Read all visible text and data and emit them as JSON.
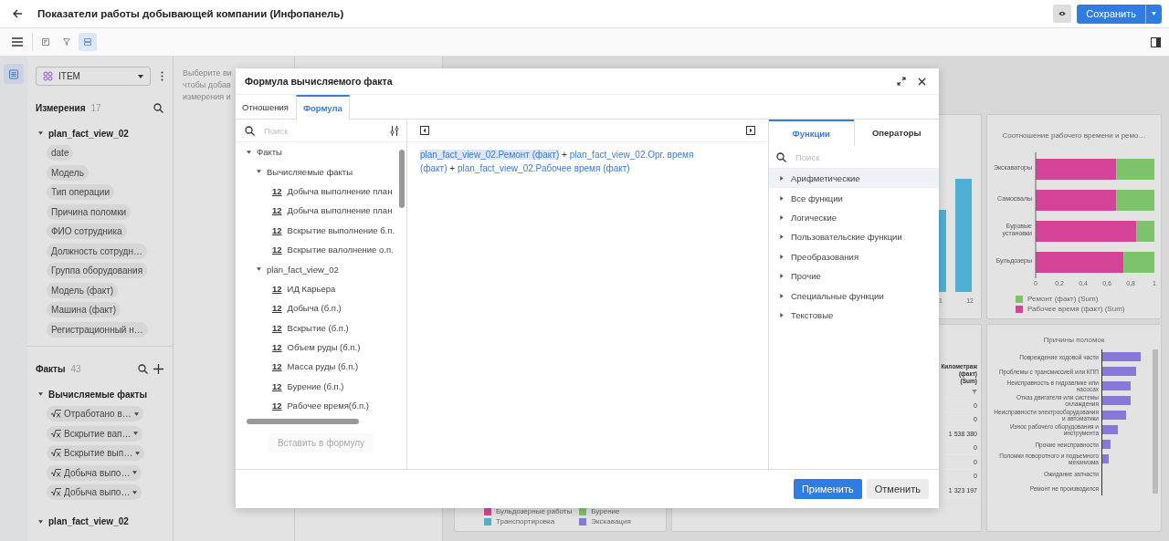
{
  "topbar": {
    "title": "Показатели работы добывающей компании (Инфопанель)",
    "save_button": "Сохранить"
  },
  "toolbar": {
    "tools": [
      {
        "kind": "report",
        "selected": false
      },
      {
        "kind": "filter",
        "selected": false
      },
      {
        "kind": "layout",
        "selected": true
      }
    ]
  },
  "sidebar": {
    "dataset": "ITEM",
    "dimensions": {
      "title": "Измерения",
      "count": "17",
      "group": {
        "label": "plan_fact_view_02",
        "expanded": true
      },
      "items": [
        "date",
        "Модель",
        "Тип операции",
        "Причина поломки",
        "ФИО сотрудника",
        "Должность сотрудн…",
        "Группа оборудования",
        "Модель (факт)",
        "Машина (факт)",
        "Регистрационный н…"
      ]
    },
    "facts": {
      "title": "Факты",
      "count": "43",
      "groups": [
        {
          "label": "Вычисляемые факты",
          "expanded": true,
          "items": [
            "Отработано в…",
            "Вскрытие вап…",
            "Вскрытие вып…",
            "Добыча выпо…",
            "Добыча выпо…"
          ]
        },
        {
          "label": "plan_fact_view_02",
          "expanded": true
        }
      ]
    }
  },
  "hint": [
    "Выберите ви",
    "чтобы добав",
    "измерения и"
  ],
  "dashboard": {
    "column_chart": {
      "labels": [
        "1",
        "12"
      ]
    },
    "ratio_chart": {
      "chart_data": {
        "type": "bar",
        "orientation": "horizontal",
        "stacked": true,
        "title": "Соотношение рабочего времени и ремо…",
        "categories": [
          "Экскаваторы",
          "Самосвалы",
          "Буровые установки",
          "Бульдозеры"
        ],
        "xlim": [
          0,
          1
        ],
        "xticks": [
          0,
          {
            "value": 0.2,
            "label": "0,2"
          },
          {
            "value": 0.4,
            "label": "0,4"
          },
          {
            "value": 0.6,
            "label": "0,6"
          },
          {
            "value": 0.8,
            "label": "0,8"
          },
          1
        ],
        "series": [
          {
            "name": "Рабочее время (факт) (Sum)",
            "color": "#d6449a",
            "values": [
              0.68,
              0.68,
              0.85,
              0.74
            ]
          },
          {
            "name": "Ремонт (факт) (Sum)",
            "color": "#7dc36b",
            "values": [
              0.32,
              0.32,
              0.15,
              0.26
            ]
          }
        ]
      }
    },
    "table": {
      "column": "Километраж (факт) (Sum)",
      "rows": [
        "0",
        "0",
        "1 538 380",
        "0",
        "0",
        "0",
        "1 323 197"
      ]
    },
    "breakdown_chart": {
      "title": "Причины поломок",
      "categories": [
        "Повреждение ходовой части",
        "Проблемы с трансмиссией или КПП",
        "Неисправность в гидравлике или насосах",
        "Отказ двигателя или системы охлаждения",
        "Неисправности электрооборудования и автоматики",
        "Износ рабочего оборудования и инструмента",
        "Прочие неисправности",
        "Поломки поворотного и подъемного механизма",
        "Ожидание запчасти",
        "Ремонт не производился"
      ]
    },
    "legend": [
      {
        "label": "Бульдозерные работы",
        "color": "#d6449a"
      },
      {
        "label": "Бурение",
        "color": "#7dc36b"
      },
      {
        "label": "Транспортировка",
        "color": "#4fb0c6"
      },
      {
        "label": "Экскавация",
        "color": "#8878d8"
      }
    ]
  },
  "modal": {
    "title": "Формула вычисляемого факта",
    "tabs": [
      {
        "label": "Отношения",
        "selected": false
      },
      {
        "label": "Формула",
        "selected": true
      }
    ],
    "tree_search": {
      "placeholder": "Поиск"
    },
    "tree": [
      {
        "label": "Факты",
        "expanded": true,
        "children": [
          {
            "label": "Вычисляемые факты",
            "expanded": true,
            "children": [
              {
                "label": "Добыча выполнение план",
                "badge": "12"
              },
              {
                "label": "Добыча выполнение план",
                "badge": "12"
              },
              {
                "label": "Вскрытие выполнение б.п.",
                "badge": "12"
              },
              {
                "label": "Вскрытие валолнение о.п.",
                "badge": "12"
              }
            ]
          },
          {
            "label": "plan_fact_view_02",
            "expanded": true,
            "children": [
              {
                "label": "ИД Карьера",
                "badge": "12"
              },
              {
                "label": "Добыча (б.п.)",
                "badge": "12"
              },
              {
                "label": "Вскрытие (б.п.)",
                "badge": "12"
              },
              {
                "label": "Объем руды (б.п.)",
                "badge": "12"
              },
              {
                "label": "Масса руды (б.п.)",
                "badge": "12"
              },
              {
                "label": "Бурение (б.п.)",
                "badge": "12"
              },
              {
                "label": "Рабочее время(б.п.)",
                "badge": "12"
              }
            ]
          }
        ]
      }
    ],
    "insert_button": {
      "label": "Вставить в формулу",
      "disabled": true
    },
    "formula": [
      {
        "kind": "field",
        "text": "plan_fact_view_02.Ремонт (факт)",
        "selected": true
      },
      {
        "kind": "operator",
        "text": "+",
        "selected": false
      },
      {
        "kind": "field",
        "text": "plan_fact_view_02.Орг. время (факт)",
        "selected": false
      },
      {
        "kind": "operator",
        "text": "+",
        "selected": false
      },
      {
        "kind": "field",
        "text": "plan_fact_view_02.Рабочее время (факт)",
        "selected": false
      }
    ],
    "function_tabs": [
      {
        "label": "Функции",
        "selected": true
      },
      {
        "label": "Операторы",
        "selected": false
      }
    ],
    "function_search": {
      "placeholder": "Поиск"
    },
    "function_groups": [
      {
        "label": "Арифметические",
        "hovered": true
      },
      {
        "label": "Все функции",
        "hovered": false
      },
      {
        "label": "Логические",
        "hovered": false
      },
      {
        "label": "Пользовательские функции",
        "hovered": false
      },
      {
        "label": "Преобразования",
        "hovered": false
      },
      {
        "label": "Прочие",
        "hovered": false
      },
      {
        "label": "Специальные функции",
        "hovered": false
      },
      {
        "label": "Текстовые",
        "hovered": false
      }
    ],
    "buttons": [
      {
        "label": "Применить",
        "kind": "primary"
      },
      {
        "label": "Отменить",
        "kind": "secondary"
      }
    ]
  }
}
